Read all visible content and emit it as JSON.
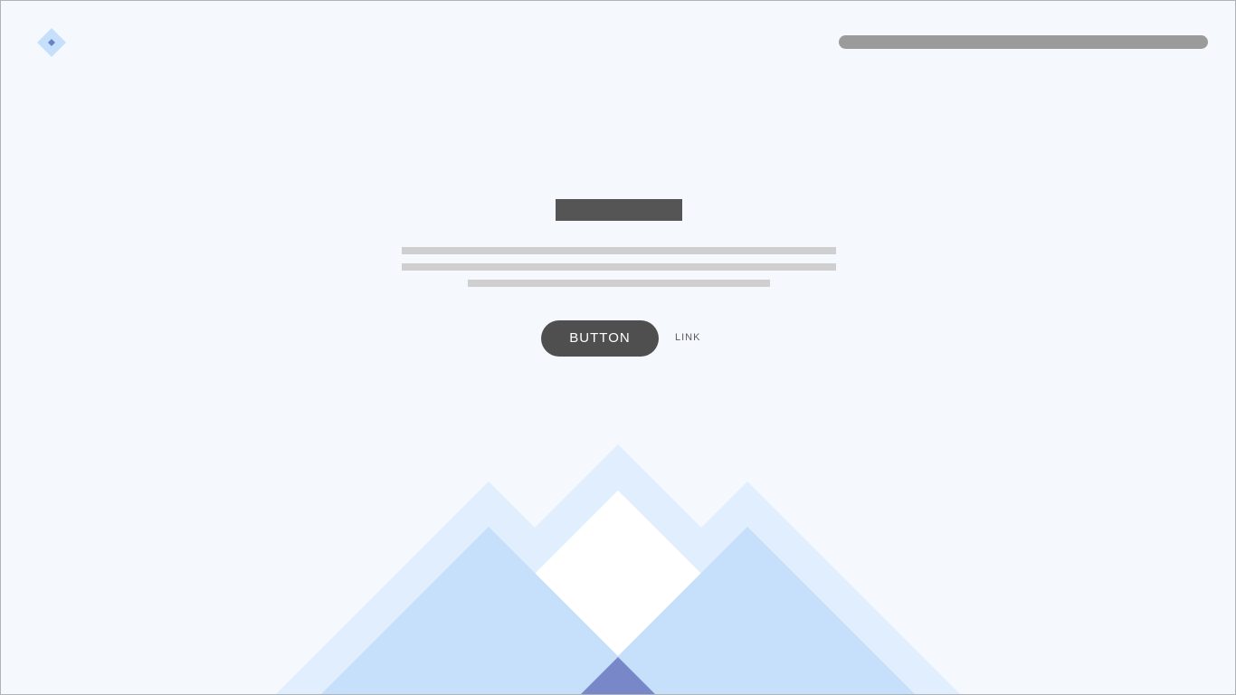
{
  "header": {
    "logo_icon": "diamond-logo-icon"
  },
  "hero": {
    "button_label": "BUTTON",
    "link_label": "LINK"
  },
  "colors": {
    "background": "#f5f9fe",
    "button": "#4f4f4f",
    "mountain_light": "#e0eefd",
    "mountain_mid": "#c6e0fb",
    "mountain_dark": "#7787c8"
  }
}
